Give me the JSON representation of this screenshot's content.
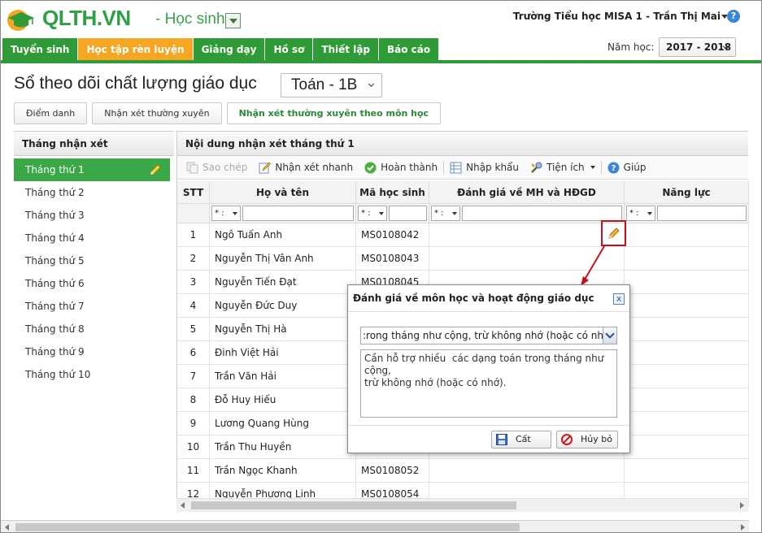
{
  "header": {
    "logo_text": "QLTH.VN",
    "role": "- Học sinh",
    "school_user": "Trường Tiểu học MISA 1 - Trần Thị Mai",
    "help": "?"
  },
  "nav": {
    "items": [
      "Tuyển sinh",
      "Học tập rèn luyện",
      "Giảng dạy",
      "Hồ sơ",
      "Thiết lập",
      "Báo cáo"
    ],
    "active_index": 1,
    "year_label": "Năm học:",
    "year_value": "2017 - 2018"
  },
  "page": {
    "title": "Sổ theo dõi chất lượng giáo dục",
    "subject": "Toán - 1B"
  },
  "subtabs": [
    "Điểm danh",
    "Nhận xét thường xuyên",
    "Nhận xét thường xuyên theo môn học"
  ],
  "left_panel": {
    "header": "Tháng nhận xét",
    "months": [
      "Tháng thứ 1",
      "Tháng thứ 2",
      "Tháng thứ 3",
      "Tháng thứ 4",
      "Tháng thứ 5",
      "Tháng thứ 6",
      "Tháng thứ 7",
      "Tháng thứ 8",
      "Tháng thứ 9",
      "Tháng thứ 10"
    ]
  },
  "right_panel": {
    "header": "Nội dung nhận xét tháng thứ 1",
    "toolbar": {
      "copy": "Sao chép",
      "quick": "Nhận xét nhanh",
      "done": "Hoàn thành",
      "import": "Nhập khẩu",
      "utils": "Tiện ích",
      "help": "Giúp"
    }
  },
  "grid": {
    "columns": [
      "STT",
      "Họ và tên",
      "Mã học sinh",
      "Đánh giá về MH và HĐGD",
      "Năng lực"
    ],
    "filter_op": "* :",
    "rows": [
      [
        "1",
        "Ngô Tuấn Anh",
        "MS0108042"
      ],
      [
        "2",
        "Nguyễn Thị Vân Anh",
        "MS0108043"
      ],
      [
        "3",
        "Nguyễn Tiến Đạt",
        "MS0108045"
      ],
      [
        "4",
        "Nguyễn Đức Duy",
        ""
      ],
      [
        "5",
        "Nguyễn Thị Hà",
        ""
      ],
      [
        "6",
        "Đinh Việt Hải",
        ""
      ],
      [
        "7",
        "Trần Văn Hải",
        ""
      ],
      [
        "8",
        "Đỗ Huy Hiếu",
        ""
      ],
      [
        "9",
        "Lương Quang Hùng",
        ""
      ],
      [
        "10",
        "Trần Thu Huyền",
        ""
      ],
      [
        "11",
        "Trần Ngọc Khanh",
        "MS0108052"
      ],
      [
        "12",
        "Nguyễn Phương Linh",
        "MS0108054"
      ]
    ]
  },
  "dialog": {
    "title": "Đánh giá về môn học và hoạt động giáo dục",
    "close": "x",
    "select_value": ":rong tháng như cộng, trừ không nhớ (hoặc có nhớ).",
    "text": "Cần hỗ trợ nhiều  các dạng toán trong tháng như cộng,\ntrừ không nhớ (hoặc có nhớ).",
    "save": "Cất",
    "cancel": "Hủy bỏ"
  },
  "colors": {
    "brand_green": "#2e9b37",
    "active_orange": "#f5a623",
    "annotation_red": "#c1121f"
  }
}
